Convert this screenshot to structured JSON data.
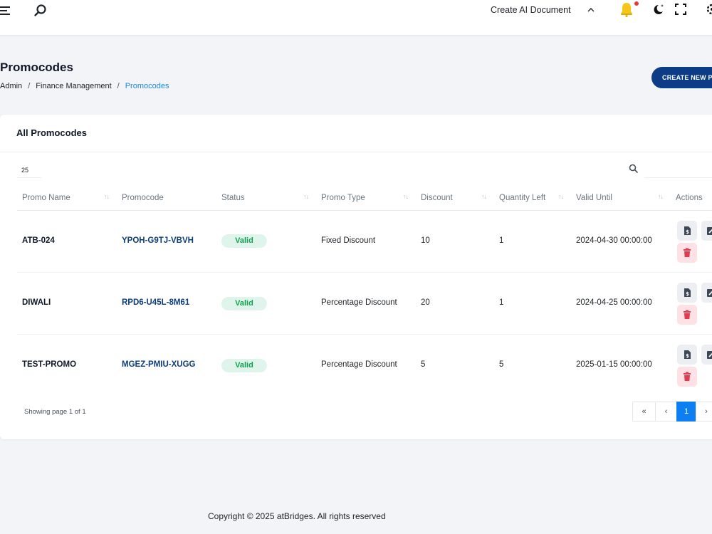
{
  "topbar": {
    "create_ai_label": "Create AI Document",
    "colors": {
      "bell": "#f5c518",
      "notification_dot": "#e53935"
    }
  },
  "page": {
    "title": "Promocodes",
    "breadcrumb": [
      "Admin",
      "Finance Management",
      "Promocodes"
    ],
    "create_button_label": "CREATE NEW PROMOCODE"
  },
  "card": {
    "title": "All Promocodes",
    "page_size": "25",
    "columns": [
      "Promo Name",
      "Promocode",
      "Status",
      "Promo Type",
      "Discount",
      "Quantity Left",
      "Valid Until",
      "Actions"
    ],
    "rows": [
      {
        "name": "ATB-024",
        "code": "YPOH-G9TJ-VBVH",
        "status": "Valid",
        "type": "Fixed Discount",
        "discount": "10",
        "quantity": "1",
        "valid_until": "2024-04-30 00:00:00"
      },
      {
        "name": "DIWALI",
        "code": "RPD6-U45L-8M61",
        "status": "Valid",
        "type": "Percentage Discount",
        "discount": "20",
        "quantity": "1",
        "valid_until": "2024-04-25 00:00:00"
      },
      {
        "name": "TEST-PROMO",
        "code": "MGEZ-PMIU-XUGG",
        "status": "Valid",
        "type": "Percentage Discount",
        "discount": "5",
        "quantity": "5",
        "valid_until": "2025-01-15 00:00:00"
      }
    ],
    "showing_text": "Showing page 1 of 1",
    "pagination": {
      "first": "«",
      "prev": "‹",
      "current": "1",
      "next": "›"
    },
    "colors": {
      "primary": "#0c3c86",
      "status_valid": "#12a150",
      "delete": "#e53950",
      "page_active": "#0d7ff2"
    }
  },
  "footer": {
    "copyright": "Copyright © 2025 atBridges. All rights reserved"
  }
}
